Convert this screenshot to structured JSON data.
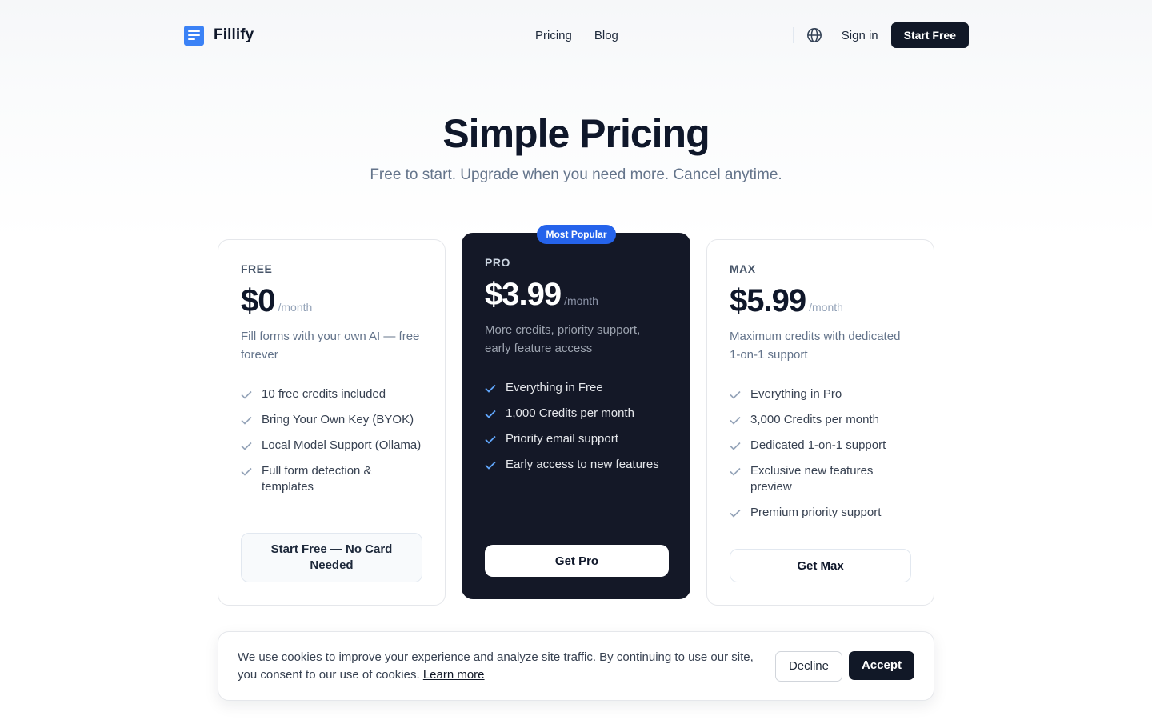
{
  "header": {
    "brand": {
      "name": "Fillify",
      "logo_icon": "document-list-icon"
    },
    "nav": [
      {
        "label": "Pricing"
      },
      {
        "label": "Blog"
      }
    ],
    "language_icon": "globe-icon",
    "sign_in_label": "Sign in",
    "cta_label": "Start Free"
  },
  "hero": {
    "title": "Simple Pricing",
    "subtitle": "Free to start. Upgrade when you need more. Cancel anytime."
  },
  "plans": [
    {
      "tier": "FREE",
      "price": "$0",
      "period": "/month",
      "description": "Fill forms with your own AI — free forever",
      "features": [
        "10 free credits included",
        "Bring Your Own Key (BYOK)",
        "Local Model Support (Ollama)",
        "Full form detection & templates"
      ],
      "button_label": "Start Free — No Card Needed"
    },
    {
      "tier": "PRO",
      "badge": "Most Popular",
      "price": "$3.99",
      "period": "/month",
      "description": "More credits, priority support, early feature access",
      "features": [
        "Everything in Free",
        "1,000 Credits per month",
        "Priority email support",
        "Early access to new features"
      ],
      "button_label": "Get Pro"
    },
    {
      "tier": "MAX",
      "price": "$5.99",
      "period": "/month",
      "description": "Maximum credits with dedicated 1-on-1 support",
      "features": [
        "Everything in Pro",
        "3,000 Credits per month",
        "Dedicated 1-on-1 support",
        "Exclusive new features preview",
        "Premium priority support"
      ],
      "button_label": "Get Max"
    }
  ],
  "cookie_banner": {
    "text": "We use cookies to improve your experience and analyze site traffic. By continuing to use our site, you consent to our use of cookies.",
    "link_label": "Learn more",
    "decline_label": "Decline",
    "accept_label": "Accept"
  },
  "colors": {
    "primary_dark": "#111827",
    "accent_blue": "#2563eb",
    "muted_text": "#64748b"
  }
}
